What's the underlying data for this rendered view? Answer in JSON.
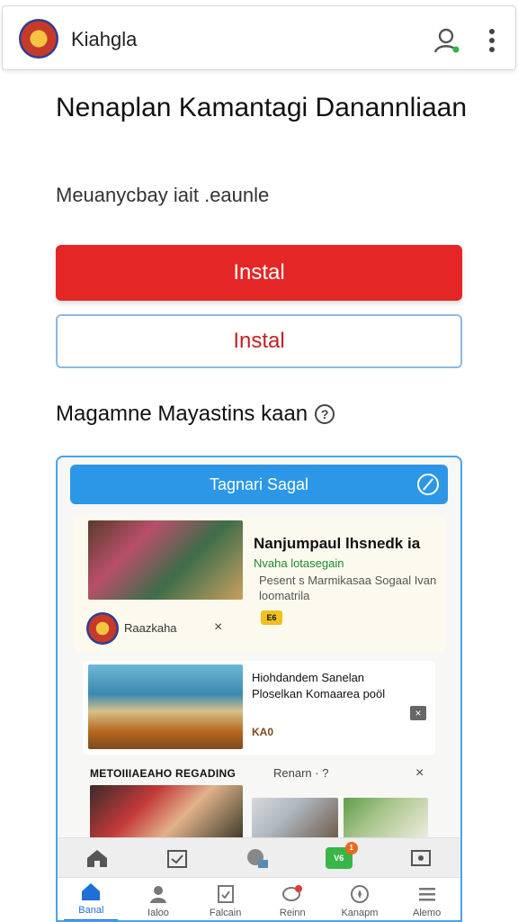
{
  "app": {
    "name": "Kiahgla"
  },
  "hero": {
    "title": "Nenaplan Kamantagi Danannliaan",
    "subtitle": "Meuanycbay iait .eaunle",
    "primary_button": "Instal",
    "secondary_button": "Instal"
  },
  "section": {
    "heading": "Magamne Mayastins kaan",
    "info_glyph": "?"
  },
  "panel": {
    "header": "Tagnari Sagal",
    "card1": {
      "headline": "Nanjumpaul lhsnedk ia",
      "tag": "Nvaha lotasegain",
      "desc": "Pesent s Marmikasaa Sogaal Ivan loomatrila",
      "badge": "E6",
      "author": "Raazkaha",
      "close": "×"
    },
    "card2": {
      "headline": "Hiohdandem Sanelan Ploselkan Komaarea poöl",
      "badge": "KA0",
      "dismiss": "×"
    },
    "row": {
      "label": "METOIIIAEAHO REGADING",
      "meta": "Renarn · ?",
      "close": "×"
    }
  },
  "toolbar": {
    "badge": "V6",
    "count": "1"
  },
  "nav": {
    "items": [
      {
        "label": "Banal",
        "icon": "home-icon",
        "active": true
      },
      {
        "label": "Ialoo",
        "icon": "person-icon",
        "active": false
      },
      {
        "label": "Falcain",
        "icon": "document-icon",
        "active": false
      },
      {
        "label": "Reinn",
        "icon": "chat-icon",
        "active": false
      },
      {
        "label": "Kanapm",
        "icon": "compass-icon",
        "active": false
      },
      {
        "label": "Alemo",
        "icon": "menu-icon",
        "active": false
      }
    ]
  },
  "colors": {
    "primary": "#e42626",
    "accent": "#2b97e6",
    "nav_active": "#1e6fd8"
  }
}
